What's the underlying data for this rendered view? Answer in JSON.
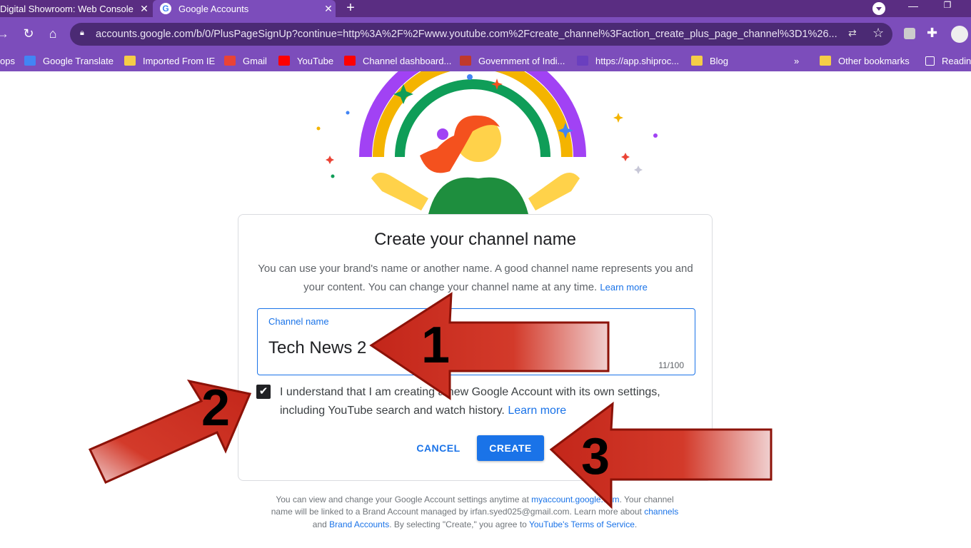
{
  "browser": {
    "tabs": [
      {
        "title": "Digital Showroom: Web Console",
        "close": "✕"
      },
      {
        "title": "Google Accounts",
        "close": "✕"
      }
    ],
    "new_tab": "+",
    "url": "accounts.google.com/b/0/PlusPageSignUp?continue=http%3A%2F%2Fwww.youtube.com%2Fcreate_channel%3Faction_create_plus_page_channel%3D1%26...",
    "bookmarks": [
      {
        "label": "ops",
        "icon": "apps-icon"
      },
      {
        "label": "Google Translate",
        "icon": "translate-icon"
      },
      {
        "label": "Imported From IE",
        "icon": "folder-icon"
      },
      {
        "label": "Gmail",
        "icon": "gmail-icon"
      },
      {
        "label": "YouTube",
        "icon": "youtube-icon"
      },
      {
        "label": "Channel dashboard...",
        "icon": "youtube-icon"
      },
      {
        "label": "Government of Indi...",
        "icon": "emblem-icon"
      },
      {
        "label": "https://app.shiproc...",
        "icon": "shiprocket-icon"
      },
      {
        "label": "Blog",
        "icon": "folder-icon"
      }
    ],
    "overflow": "»",
    "other_bookmarks": "Other bookmarks",
    "reading_list": "Readin"
  },
  "dialog": {
    "title": "Create your channel name",
    "description": "You can use your brand's name or another name. A good channel name represents you and your content. You can change your channel name at any time.",
    "description_link": "Learn more",
    "field_label": "Channel name",
    "field_value": "Tech News 2",
    "counter": "11/100",
    "consent_text": "I understand that I am creating a new Google Account with its own settings, including YouTube search and watch history.",
    "consent_link": "Learn more",
    "cancel": "CANCEL",
    "create": "CREATE"
  },
  "footer": {
    "text1": "You can view and change your Google Account settings anytime at",
    "link1": "myaccount.google.com",
    "text2": ". Your channel name will be linked to a Brand Account managed by irfan.syed025@gmail.com. Learn more about",
    "link2": "channels",
    "text3": "and",
    "link3": "Brand Accounts",
    "text4": ". By selecting \"Create,\" you agree to",
    "link4": "YouTube's Terms of Service",
    "text5": "."
  },
  "annotations": {
    "arrow1": "1",
    "arrow2": "2",
    "arrow3": "3"
  },
  "colors": {
    "browser_frame": "#7c4dbb",
    "tab_strip": "#5a2d82",
    "accent": "#1a73e8",
    "arrow_red": "#c3261a"
  }
}
